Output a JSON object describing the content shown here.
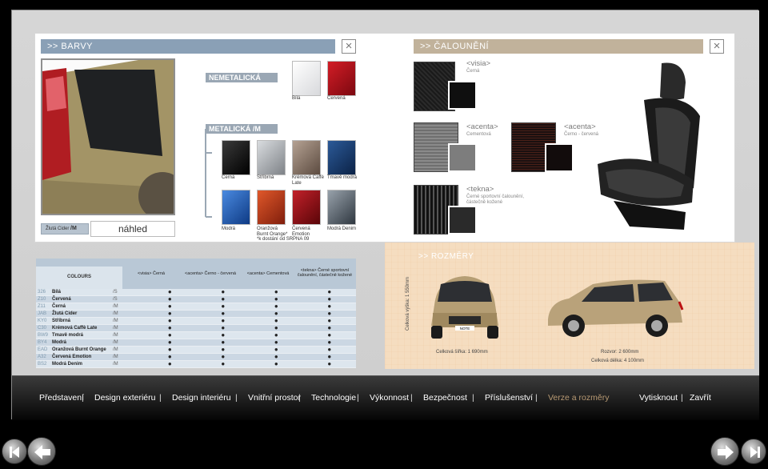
{
  "colors_panel": {
    "title": ">> BARVY"
  },
  "upholstery_panel": {
    "title": ">> ČALOUNĚNÍ"
  },
  "preview": {
    "swatch_label": "Žlutá Cider",
    "swatch_type": "/M",
    "preview_label": "náhled"
  },
  "nonmetallic": {
    "label": "NEMETALICKÁ",
    "swatches": [
      {
        "name": "Bílá",
        "color": "#e8e8ea"
      },
      {
        "name": "Červená",
        "color": "#b0101a"
      }
    ]
  },
  "metallic": {
    "label": "METALICKÁ  /M",
    "row1": [
      {
        "name": "Černá",
        "color": "#111111"
      },
      {
        "name": "Stříbrná",
        "color": "#a9adb2"
      },
      {
        "name": "Krémová Caffè Late",
        "color": "#8e786a"
      },
      {
        "name": "Tmavě modrá",
        "color": "#163a6e"
      }
    ],
    "row2": [
      {
        "name": "Modrá",
        "color": "#1f5fb4"
      },
      {
        "name": "Oranžová Burnt Orange*",
        "color": "#b43416"
      },
      {
        "name": "Červená Emotion",
        "color": "#8e0f16"
      },
      {
        "name": "Modrá Denim",
        "color": "#5c6670"
      }
    ],
    "footnote": "*k dostání od SRPNA 09"
  },
  "fabrics": [
    {
      "trim": "<visia>",
      "desc": "Černá"
    },
    {
      "trim": "<acenta>",
      "desc": "Cementová"
    },
    {
      "trim": "<acenta>",
      "desc": "Černo - červená"
    },
    {
      "trim": "<tekna>",
      "desc": "Černé sportovní čalounění, částečně kožené"
    }
  ],
  "colours_table": {
    "header": {
      "colours": "COLOURS",
      "c1": "<visia> Černá",
      "c2": "<acenta> Černo - červená",
      "c3": "<acenta> Cementová",
      "c4": "<tekna> Černé sportovní čalounění, částečně kožené"
    },
    "rows": [
      {
        "code": "326",
        "name": "Bílá",
        "type": "/S",
        "marks": [
          true,
          true,
          true,
          true
        ]
      },
      {
        "code": "Z10",
        "name": "Červená",
        "type": "/S",
        "marks": [
          true,
          true,
          true,
          true
        ]
      },
      {
        "code": "Z11",
        "name": "Černá",
        "type": "/M",
        "marks": [
          true,
          true,
          true,
          true
        ]
      },
      {
        "code": "JAB",
        "name": "Žlutá Cider",
        "type": "/M",
        "marks": [
          true,
          true,
          true,
          true
        ]
      },
      {
        "code": "KY0",
        "name": "Stříbrná",
        "type": "/M",
        "marks": [
          true,
          true,
          true,
          true
        ]
      },
      {
        "code": "C30",
        "name": "Krémová Caffè Late",
        "type": "/M",
        "marks": [
          true,
          true,
          true,
          true
        ]
      },
      {
        "code": "BW9",
        "name": "Tmavě modrá",
        "type": "/M",
        "marks": [
          true,
          true,
          true,
          true
        ]
      },
      {
        "code": "BY4",
        "name": "Modrá",
        "type": "/M",
        "marks": [
          true,
          true,
          true,
          true
        ]
      },
      {
        "code": "EAD",
        "name": "Oranžová Burnt Orange",
        "type": "/M",
        "marks": [
          true,
          true,
          true,
          true
        ]
      },
      {
        "code": "A32",
        "name": "Červená Emotion",
        "type": "/M",
        "marks": [
          true,
          true,
          true,
          true
        ]
      },
      {
        "code": "BS2",
        "name": "Modrá Denim",
        "type": "/M",
        "marks": [
          true,
          true,
          true,
          true
        ]
      }
    ]
  },
  "dimensions": {
    "title": ">> ROZMĚRY",
    "height": "Celková výška: 1 550mm",
    "width": "Celková šířka: 1 690mm",
    "wheelbase": "Rozvor: 2 600mm",
    "length": "Celková délka: 4 100mm",
    "plate": "NOTE"
  },
  "nav": {
    "items": [
      "Představení",
      "Design exteriéru",
      "Design interiéru",
      "Vnitřní prostor",
      "Technologie",
      "Výkonnost",
      "Bezpečnost",
      "Příslušenství",
      "Verze a rozměry"
    ],
    "print": "Vytisknout",
    "close": "Zavřít",
    "active_color": "#b89a74"
  }
}
